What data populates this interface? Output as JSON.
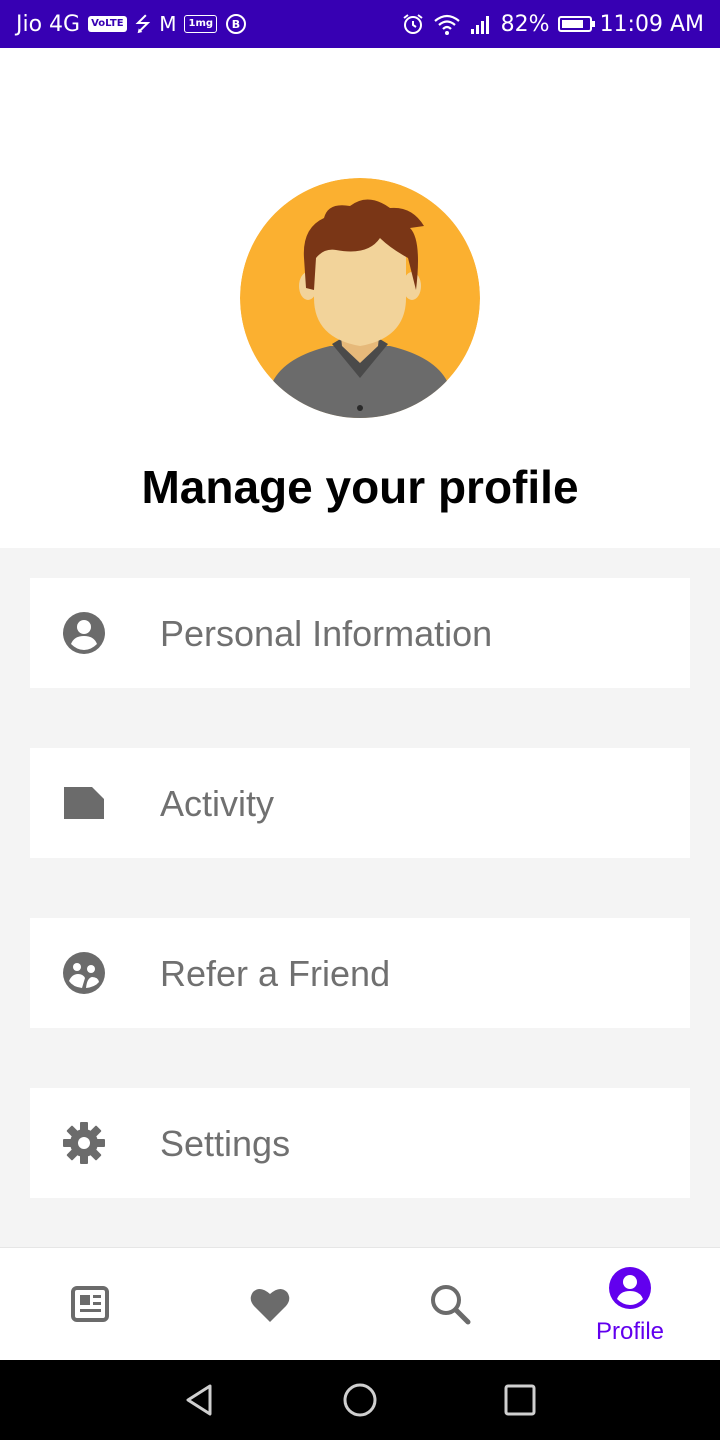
{
  "status_bar": {
    "carrier": "Jio 4G",
    "volte_badge": "VoLTE",
    "battery_percent": "82%",
    "battery_level": 0.82,
    "time": "11:09 AM",
    "icons": [
      "usb-icon",
      "gmail-icon",
      "tata-1mg-icon",
      "b-badge-icon",
      "alarm-icon",
      "wifi-icon",
      "signal-icon",
      "battery-icon"
    ]
  },
  "header": {
    "title": "Manage your profile",
    "avatar_icon": "user-avatar-illustration"
  },
  "menu": {
    "items": [
      {
        "label": "Personal Information",
        "icon": "account-circle-icon"
      },
      {
        "label": "Activity",
        "icon": "note-icon"
      },
      {
        "label": "Refer a Friend",
        "icon": "refer-friend-icon"
      },
      {
        "label": "Settings",
        "icon": "gear-icon"
      }
    ]
  },
  "bottom_nav": {
    "items": [
      {
        "icon": "newspaper-icon",
        "label": "",
        "active": false
      },
      {
        "icon": "heart-icon",
        "label": "",
        "active": false
      },
      {
        "icon": "search-icon",
        "label": "",
        "active": false
      },
      {
        "icon": "profile-icon",
        "label": "Profile",
        "active": true
      }
    ]
  },
  "colors": {
    "status_bar": "#3700b3",
    "accent": "#6200ee",
    "menu_text": "#707070",
    "icon_gray": "#6b6b6b",
    "content_bg": "#f4f4f4",
    "avatar_bg": "#fbb030"
  }
}
